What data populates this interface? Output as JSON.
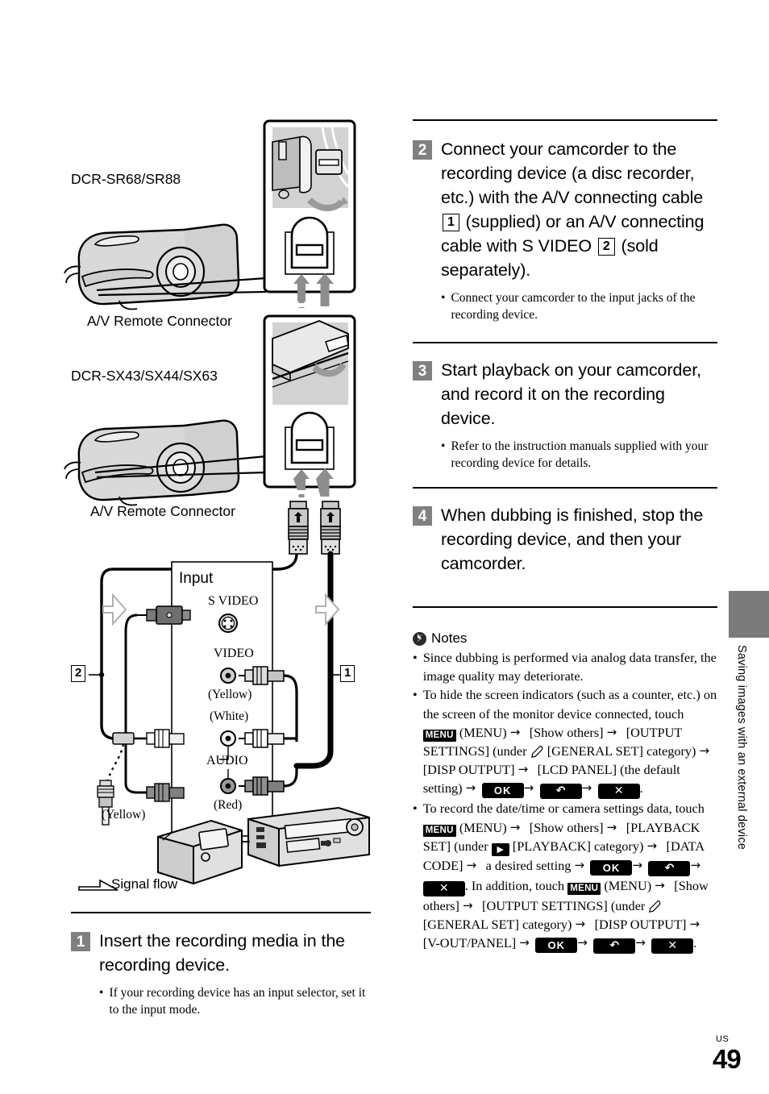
{
  "page": {
    "number": "49",
    "region_code": "US",
    "side_tab_text": "Saving images with an external device"
  },
  "diagram": {
    "model_label_1": "DCR-SR68/SR88",
    "model_label_2": "DCR-SX43/SX44/SX63",
    "connector_label_1": "A/V Remote Connector",
    "connector_label_2": "A/V Remote Connector",
    "input_title": "Input",
    "jack_s_video": "S VIDEO",
    "jack_video": "VIDEO",
    "jack_audio": "AUDIO",
    "color_yellow_video": "(Yellow)",
    "color_white": "(White)",
    "color_red": "(Red)",
    "color_yellow_plug": "(Yellow)",
    "cable_marker_1": "1",
    "cable_marker_2": "2",
    "signal_flow": "Signal flow"
  },
  "steps": [
    {
      "num": "1",
      "title": "Insert the recording media in the recording device.",
      "bullets": [
        "If your recording device has an input selector, set it to the input mode."
      ]
    },
    {
      "num": "2",
      "title_parts": [
        {
          "type": "text",
          "value": "Connect your camcorder to the recording device (a disc recorder, etc.) with the A/V connecting cable "
        },
        {
          "type": "boxnum",
          "value": "1"
        },
        {
          "type": "text",
          "value": " (supplied) or an A/V connecting cable with S VIDEO "
        },
        {
          "type": "boxnum",
          "value": "2"
        },
        {
          "type": "text",
          "value": " (sold separately)."
        }
      ],
      "bullets": [
        "Connect your camcorder to the input jacks of the recording device."
      ]
    },
    {
      "num": "3",
      "title": "Start playback on your camcorder, and record it on the recording device.",
      "bullets": [
        "Refer to the instruction manuals supplied with your recording device for details."
      ]
    },
    {
      "num": "4",
      "title": "When dubbing is finished, stop the recording device, and then your camcorder.",
      "bullets": []
    }
  ],
  "notes": {
    "heading": "Notes",
    "icon": "flash-notes-icon",
    "items": [
      {
        "id": "note-analog-quality",
        "parts": [
          {
            "type": "text",
            "value": "Since dubbing is performed via analog data transfer, the image quality may deteriorate."
          }
        ]
      },
      {
        "id": "note-hide-indicators",
        "parts": [
          {
            "type": "text",
            "value": "To hide the screen indicators (such as a counter, etc.) on the screen of the monitor device connected, touch "
          },
          {
            "type": "key-menu",
            "value": "MENU"
          },
          {
            "type": "text",
            "value": " (MENU) "
          },
          {
            "type": "arrow",
            "value": "→"
          },
          {
            "type": "text",
            "value": " [Show others] "
          },
          {
            "type": "arrow",
            "value": "→"
          },
          {
            "type": "text",
            "value": " [OUTPUT SETTINGS] (under "
          },
          {
            "type": "icon-wrench",
            "value": "wrench"
          },
          {
            "type": "text",
            "value": " [GENERAL SET] category) "
          },
          {
            "type": "arrow",
            "value": "→"
          },
          {
            "type": "text",
            "value": " [DISP OUTPUT] "
          },
          {
            "type": "arrow",
            "value": "→"
          },
          {
            "type": "text",
            "value": " [LCD PANEL] (the default setting) "
          },
          {
            "type": "arrow",
            "value": "→"
          },
          {
            "type": "key-ok",
            "value": "OK"
          },
          {
            "type": "arrow",
            "value": "→"
          },
          {
            "type": "key-back",
            "value": "↶"
          },
          {
            "type": "arrow",
            "value": "→"
          },
          {
            "type": "key-close",
            "value": "✕"
          },
          {
            "type": "text",
            "value": "."
          }
        ]
      },
      {
        "id": "note-data-code",
        "parts": [
          {
            "type": "text",
            "value": "To record the date/time or camera settings data, touch "
          },
          {
            "type": "key-menu",
            "value": "MENU"
          },
          {
            "type": "text",
            "value": " (MENU) "
          },
          {
            "type": "arrow",
            "value": "→"
          },
          {
            "type": "text",
            "value": " [Show others] "
          },
          {
            "type": "arrow",
            "value": "→"
          },
          {
            "type": "text",
            "value": " [PLAYBACK SET] (under "
          },
          {
            "type": "key-play",
            "value": "▶"
          },
          {
            "type": "text",
            "value": " [PLAYBACK] category) "
          },
          {
            "type": "arrow",
            "value": "→"
          },
          {
            "type": "text",
            "value": " [DATA CODE] "
          },
          {
            "type": "arrow",
            "value": "→"
          },
          {
            "type": "text",
            "value": " a desired setting "
          },
          {
            "type": "arrow",
            "value": "→"
          },
          {
            "type": "key-ok",
            "value": "OK"
          },
          {
            "type": "arrow",
            "value": "→"
          },
          {
            "type": "key-back",
            "value": "↶"
          },
          {
            "type": "arrow",
            "value": "→"
          },
          {
            "type": "key-close",
            "value": "✕"
          },
          {
            "type": "text",
            "value": ". In addition, touch "
          },
          {
            "type": "key-menu",
            "value": "MENU"
          },
          {
            "type": "text",
            "value": " (MENU) "
          },
          {
            "type": "arrow",
            "value": "→"
          },
          {
            "type": "text",
            "value": " [Show others] "
          },
          {
            "type": "arrow",
            "value": "→"
          },
          {
            "type": "text",
            "value": " [OUTPUT SETTINGS] (under "
          },
          {
            "type": "icon-wrench",
            "value": "wrench"
          },
          {
            "type": "text",
            "value": " [GENERAL SET] category) "
          },
          {
            "type": "arrow",
            "value": "→"
          },
          {
            "type": "text",
            "value": " [DISP OUTPUT] "
          },
          {
            "type": "arrow",
            "value": "→"
          },
          {
            "type": "text",
            "value": " [V-OUT/PANEL] "
          },
          {
            "type": "arrow",
            "value": "→"
          },
          {
            "type": "key-ok",
            "value": "OK"
          },
          {
            "type": "arrow",
            "value": "→"
          },
          {
            "type": "key-back",
            "value": "↶"
          },
          {
            "type": "arrow",
            "value": "→"
          },
          {
            "type": "key-close",
            "value": "✕"
          },
          {
            "type": "text",
            "value": "."
          }
        ]
      }
    ]
  },
  "colors": {
    "step_badge": "#808080",
    "side_tab": "#7b7b7b",
    "rule": "#000000",
    "device_fill": "#d4d4d4"
  }
}
